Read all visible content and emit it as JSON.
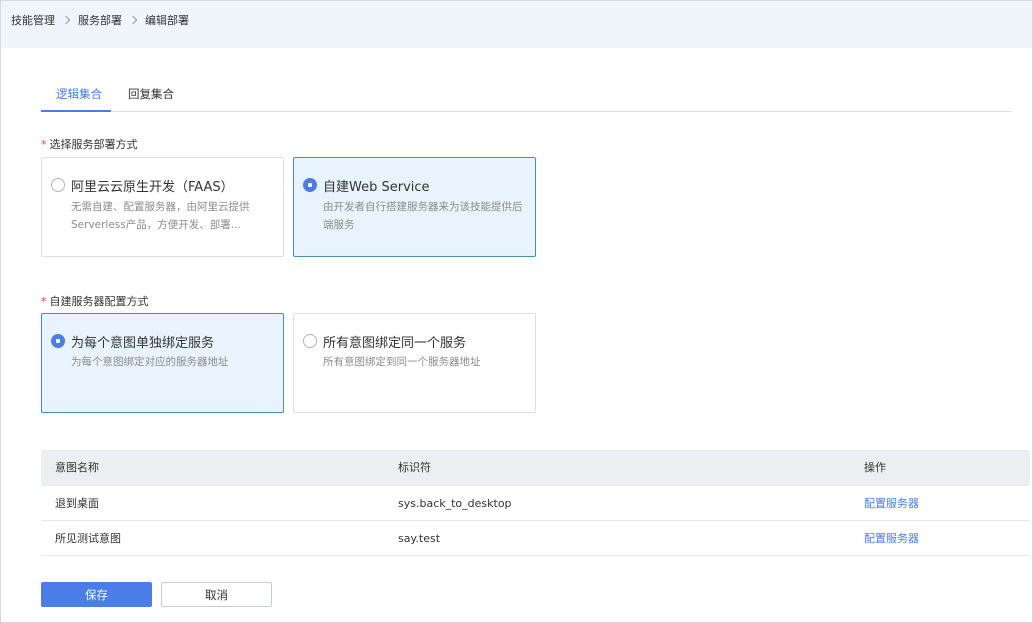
{
  "breadcrumb": [
    "技能管理",
    "服务部署",
    "编辑部署"
  ],
  "tabs": [
    {
      "label": "逻辑集合",
      "active": true
    },
    {
      "label": "回复集合",
      "active": false
    }
  ],
  "deploy_method": {
    "label": "选择服务部署方式",
    "required_mark": "*",
    "options": [
      {
        "title": "阿里云云原生开发（FAAS）",
        "desc": "无需自建、配置服务器，由阿里云提供Serverless产品，方便开发、部署...",
        "selected": false
      },
      {
        "title": "自建Web Service",
        "desc": "由开发者自行搭建服务器来为该技能提供后端服务",
        "selected": true
      }
    ]
  },
  "server_config": {
    "label": "自建服务器配置方式",
    "required_mark": "*",
    "options": [
      {
        "title": "为每个意图单独绑定服务",
        "desc": "为每个意图绑定对应的服务器地址",
        "selected": true
      },
      {
        "title": "所有意图绑定同一个服务",
        "desc": "所有意图绑定到同一个服务器地址",
        "selected": false
      }
    ]
  },
  "table": {
    "headers": [
      "意图名称",
      "标识符",
      "操作"
    ],
    "rows": [
      {
        "name": "退到桌面",
        "id": "sys.back_to_desktop",
        "action": "配置服务器"
      },
      {
        "name": "所见测试意图",
        "id": "say.test",
        "action": "配置服务器"
      }
    ]
  },
  "buttons": {
    "save": "保存",
    "cancel": "取消"
  },
  "colors": {
    "accent": "#4a7de8",
    "selected_bg": "#e8f3fd",
    "required": "#e0433a"
  }
}
